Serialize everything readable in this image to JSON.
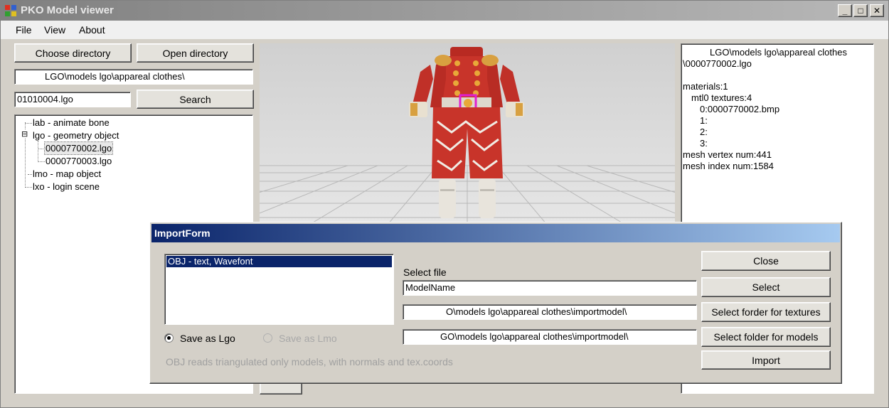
{
  "window": {
    "title": "PKO Model viewer",
    "minimize": "_",
    "maximize": "□",
    "close": "✕"
  },
  "menu": [
    "File",
    "View",
    "About"
  ],
  "left_panel": {
    "choose_directory": "Choose directory",
    "open_directory": "Open directory",
    "directory_path": "LGO\\models lgo\\appareal clothes\\",
    "search_value": "01010004.lgo",
    "search_button": "Search",
    "tree": [
      {
        "label": "lab - animate bone",
        "level": 0
      },
      {
        "label": "lgo - geometry object",
        "level": 0,
        "expanded": true,
        "toggle": "⊟"
      },
      {
        "label": "0000770002.lgo",
        "level": 1,
        "selected": true
      },
      {
        "label": "0000770003.lgo",
        "level": 1
      },
      {
        "label": "lmo - map object",
        "level": 0
      },
      {
        "label": "lxo - login scene",
        "level": 0
      }
    ]
  },
  "info_panel": {
    "lines": [
      "LGO\\models lgo\\appareal clothes",
      "\\0000770002.lgo",
      "",
      "materials:1",
      "mtl0 textures:4",
      "0:0000770002.bmp",
      "1:",
      "2:",
      "3:",
      "mesh vertex num:441",
      "mesh index num:1584"
    ]
  },
  "import_form": {
    "title": "ImportForm",
    "formats": [
      "OBJ - text, Wavefont"
    ],
    "select_file_label": "Select file",
    "file_name": "ModelName",
    "textures_folder": "O\\models lgo\\appareal clothes\\importmodel\\",
    "models_folder": "GO\\models lgo\\appareal clothes\\importmodel\\",
    "save_as_lgo": "Save as Lgo",
    "save_as_lmo": "Save as Lmo",
    "note": "OBJ reads triangulated only models, with normals and tex.coords",
    "buttons": {
      "close": "Close",
      "select": "Select",
      "select_textures": "Select forder for textures",
      "select_models": "Select folder for models",
      "import": "Import"
    }
  },
  "colors": {
    "dialog_title_start": "#0a246a",
    "dialog_title_end": "#a6caf0",
    "selection": "#0a246a",
    "model_red": "#c8342a",
    "model_gold": "#e8a838"
  }
}
